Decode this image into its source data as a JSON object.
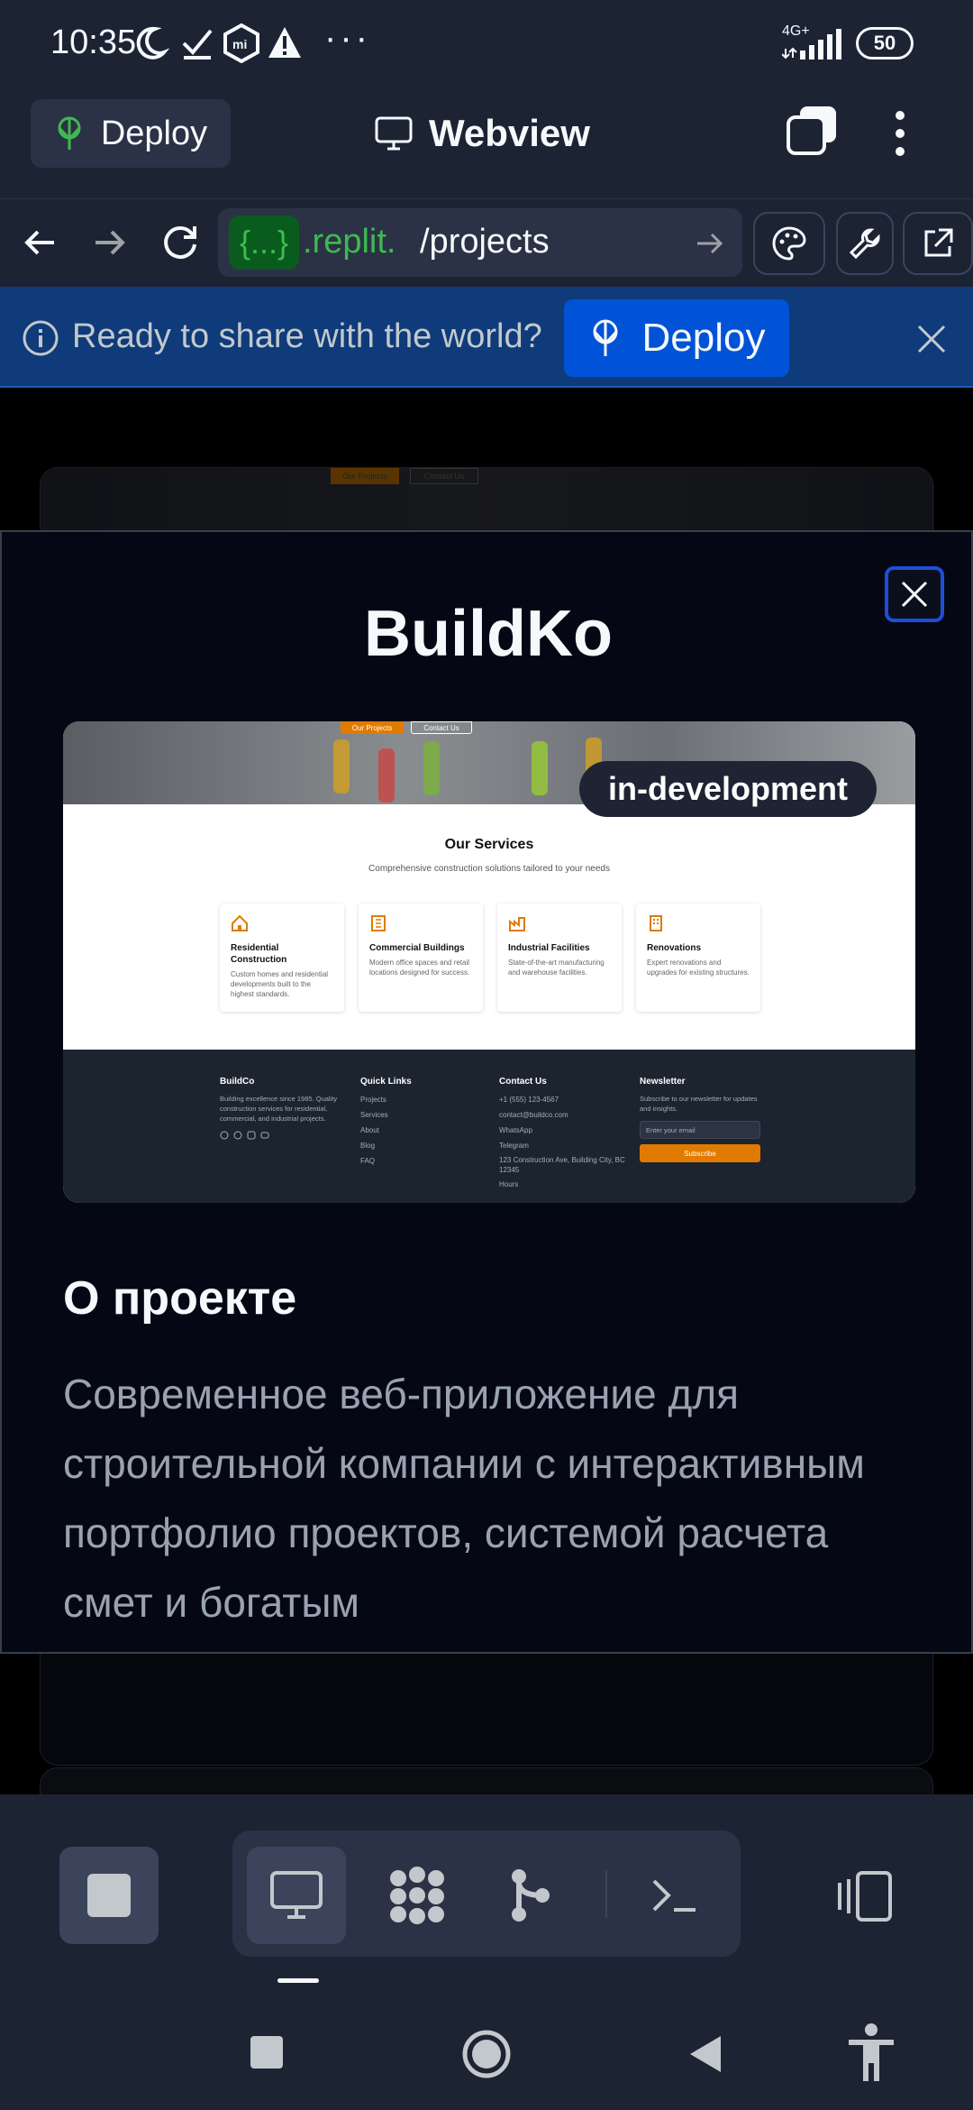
{
  "status_bar": {
    "time": "10:35",
    "network": "4G+",
    "battery": "50"
  },
  "top_bar": {
    "deploy_label": "Deploy",
    "title": "Webview"
  },
  "nav_bar": {
    "url_highlight": "{...}",
    "url_domain": ".replit.",
    "url_path": "/projects"
  },
  "banner": {
    "message": "Ready to share with the world?",
    "deploy_label": "Deploy"
  },
  "modal": {
    "title": "BuildKo",
    "badge": "in-development",
    "about_heading": "О проекте",
    "about_text": "Современное веб-приложение для строительной компании с интерактивным портфолио проектов, системой расчета смет и богатым",
    "preview": {
      "hero_buttons": [
        "Our Projects",
        "Contact Us"
      ],
      "services_title": "Our Services",
      "services_subtitle": "Comprehensive construction solutions tailored to your needs",
      "services": [
        {
          "title": "Residential Construction",
          "desc": "Custom homes and residential developments built to the highest standards."
        },
        {
          "title": "Commercial Buildings",
          "desc": "Modern office spaces and retail locations designed for success."
        },
        {
          "title": "Industrial Facilities",
          "desc": "State-of-the-art manufacturing and warehouse facilities."
        },
        {
          "title": "Renovations",
          "desc": "Expert renovations and upgrades for existing structures."
        }
      ],
      "footer": {
        "brand": "BuildCo",
        "brand_text": "Building excellence since 1985. Quality construction services for residential, commercial, and industrial projects.",
        "quick_links_title": "Quick Links",
        "quick_links": [
          "Projects",
          "Services",
          "About",
          "Blog",
          "FAQ"
        ],
        "contact_title": "Contact Us",
        "contact": [
          "+1 (555) 123-4567",
          "contact@buildco.com",
          "WhatsApp",
          "Telegram",
          "123 Construction Ave, Building City, BC 12345",
          "Hours"
        ],
        "newsletter_title": "Newsletter",
        "newsletter_text": "Subscribe to our newsletter for updates and insights.",
        "email_placeholder": "Enter your email",
        "subscribe_label": "Subscribe"
      }
    },
    "bg_hero_buttons": [
      "Our Projects",
      "Contact Us"
    ]
  },
  "colors": {
    "accent": "#0f3b7a",
    "deploy_button": "#0053d6",
    "orange": "#e07b00",
    "modal_bg": "#050814"
  }
}
